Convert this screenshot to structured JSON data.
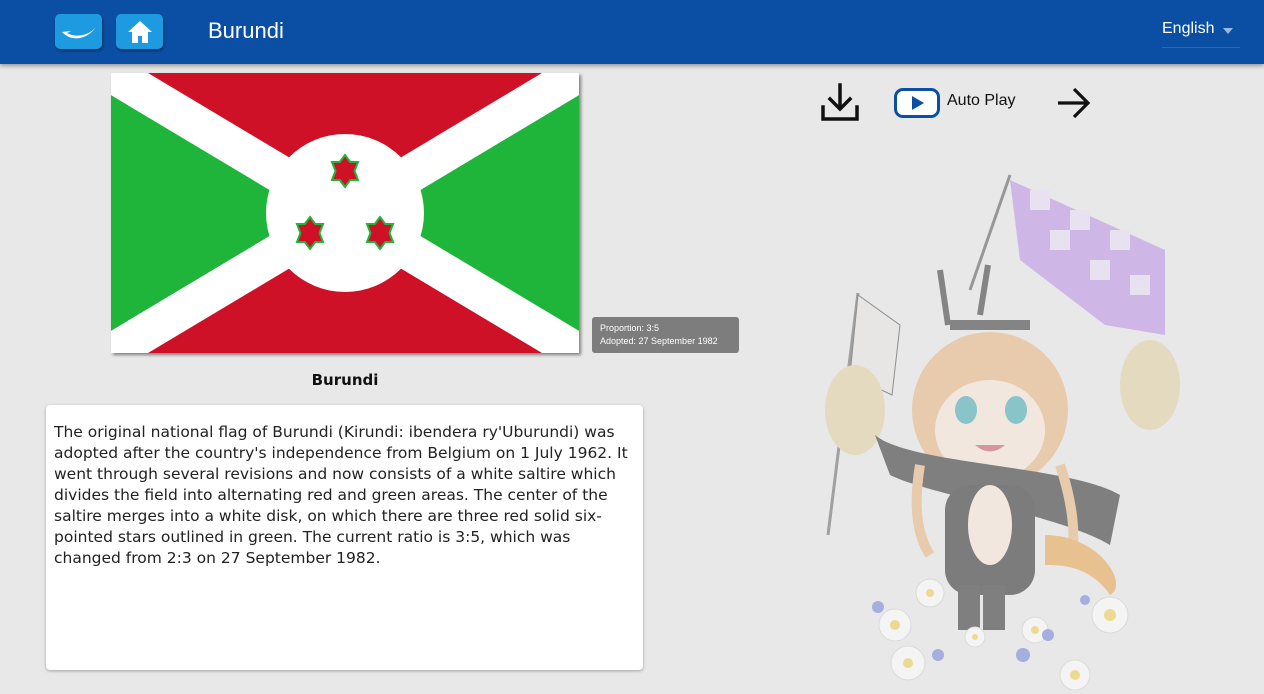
{
  "header": {
    "title": "Burundi",
    "language": "English",
    "logo_icon": "logo-swoosh-icon",
    "home_icon": "home-icon",
    "colors": {
      "bar": "#0a4fa3",
      "icon_button": "#1e9be0"
    }
  },
  "flag": {
    "caption": "Burundi",
    "info": {
      "proportion": "Proportion: 3:5",
      "adopted": "Adopted: 27 September 1982"
    },
    "colors": {
      "red": "#ce1126",
      "green": "#1eb53a",
      "white": "#ffffff"
    }
  },
  "description": "The original national flag of Burundi (Kirundi: ibendera ry'Uburundi) was adopted after the country's independence from Belgium on 1 July 1962. It went through several revisions and now consists of a white saltire which divides the field into alternating red and green areas. The center of the saltire merges into a white disk, on which there are three red solid six-pointed stars outlined in green. The current ratio is 3:5, which was changed from 2:3 on 27 September 1982.",
  "controls": {
    "download_icon": "download-icon",
    "autoplay_label": "Auto Play",
    "autoplay_icon": "play-icon",
    "next_icon": "arrow-right-icon"
  }
}
